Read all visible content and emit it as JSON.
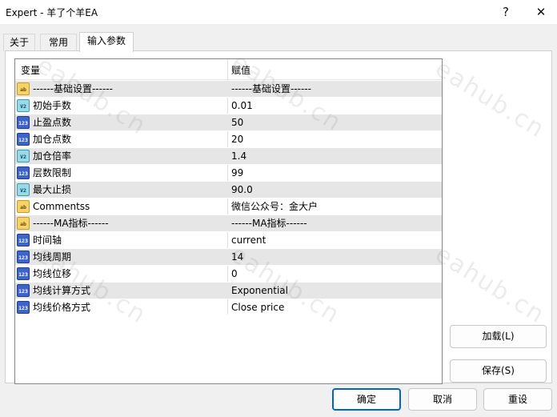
{
  "window": {
    "title": "Expert - 羊了个羊EA",
    "help_label": "?",
    "close_label": "✕"
  },
  "tabs": [
    {
      "label": "关于"
    },
    {
      "label": "常用"
    },
    {
      "label": "输入参数"
    }
  ],
  "grid": {
    "headers": {
      "variable": "变量",
      "value": "赋值"
    },
    "rows": [
      {
        "type": "ab",
        "name": "------基础设置------",
        "value": "------基础设置------"
      },
      {
        "type": "V2",
        "name": "初始手数",
        "value": "0.01"
      },
      {
        "type": "123",
        "name": "止盈点数",
        "value": "50"
      },
      {
        "type": "123",
        "name": "加仓点数",
        "value": "20"
      },
      {
        "type": "V2",
        "name": "加仓倍率",
        "value": "1.4"
      },
      {
        "type": "123",
        "name": "层数限制",
        "value": "99"
      },
      {
        "type": "V2",
        "name": "最大止损",
        "value": "90.0"
      },
      {
        "type": "ab",
        "name": "Commentss",
        "value": "微信公众号：金大户"
      },
      {
        "type": "ab",
        "name": "------MA指标------",
        "value": "------MA指标------"
      },
      {
        "type": "123",
        "name": "时间轴",
        "value": "current"
      },
      {
        "type": "123",
        "name": "均线周期",
        "value": "14"
      },
      {
        "type": "123",
        "name": "均线位移",
        "value": "0"
      },
      {
        "type": "123",
        "name": "均线计算方式",
        "value": "Exponential"
      },
      {
        "type": "123",
        "name": "均线价格方式",
        "value": "Close price"
      }
    ]
  },
  "side_buttons": {
    "load_label": "加载(L)",
    "save_label": "保存(S)"
  },
  "bottom_buttons": {
    "ok_label": "确定",
    "cancel_label": "取消",
    "reset_label": "重设"
  },
  "watermark": "eahub.cn",
  "colors": {
    "accent": "#0067c0",
    "alt_row": "#e6e6e6",
    "icon_string": "#f6d36a",
    "icon_double": "#9ad9e8",
    "icon_int": "#3e63c9"
  }
}
